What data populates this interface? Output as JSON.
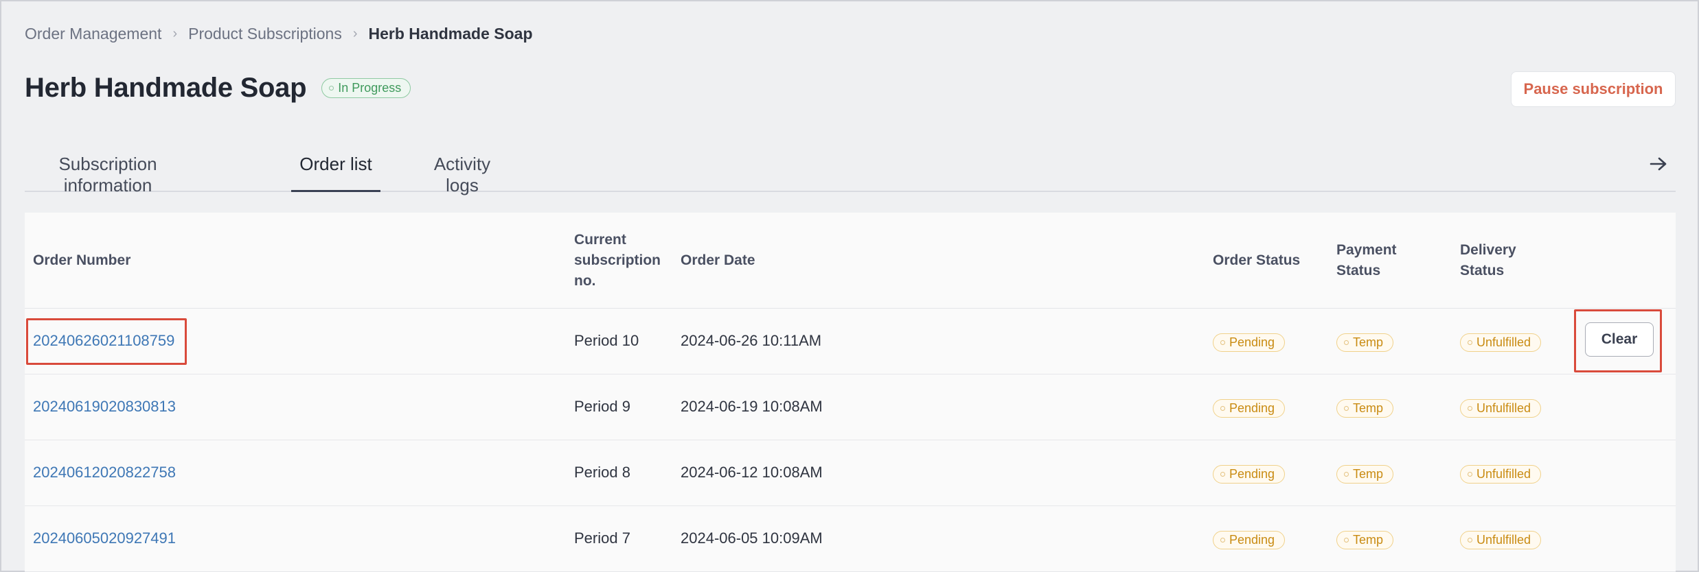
{
  "breadcrumb": {
    "items": [
      "Order Management",
      "Product Subscriptions"
    ],
    "current": "Herb Handmade Soap"
  },
  "header": {
    "title": "Herb Handmade Soap",
    "status": "In Progress",
    "pause_label": "Pause subscription"
  },
  "tabs": {
    "items": [
      {
        "label": "Subscription information"
      },
      {
        "label": "Order list"
      },
      {
        "label": "Activity logs"
      }
    ],
    "active": "Order list"
  },
  "table": {
    "headers": {
      "order_number": "Order Number",
      "subscription_no_lines": [
        "Current",
        "subscription",
        "no."
      ],
      "order_date": "Order Date",
      "order_status": "Order Status",
      "payment_status_lines": [
        "Payment",
        "Status"
      ],
      "delivery_status_lines": [
        "Delivery",
        "Status"
      ]
    },
    "rows": [
      {
        "order_number": "20240626021108759",
        "period": "Period 10",
        "date": "2024-06-26 10:11AM",
        "order_status": "Pending",
        "payment_status": "Temp",
        "delivery_status": "Unfulfilled",
        "action": "Clear"
      },
      {
        "order_number": "20240619020830813",
        "period": "Period 9",
        "date": "2024-06-19 10:08AM",
        "order_status": "Pending",
        "payment_status": "Temp",
        "delivery_status": "Unfulfilled"
      },
      {
        "order_number": "20240612020822758",
        "period": "Period 8",
        "date": "2024-06-12 10:08AM",
        "order_status": "Pending",
        "payment_status": "Temp",
        "delivery_status": "Unfulfilled"
      },
      {
        "order_number": "20240605020927491",
        "period": "Period 7",
        "date": "2024-06-05 10:09AM",
        "order_status": "Pending",
        "payment_status": "Temp",
        "delivery_status": "Unfulfilled"
      }
    ]
  },
  "colors": {
    "link": "#3e77b5",
    "pause": "#d7664e",
    "in_progress": "#3f9a5c",
    "pending_tag": "#c98b12",
    "highlight": "#d94a3b"
  },
  "icons": {
    "tab_scroll": "arrow-right-icon",
    "breadcrumb_separator": "chevron-right-icon"
  }
}
